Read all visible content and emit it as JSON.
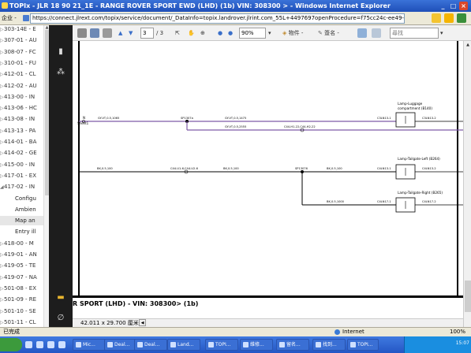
{
  "window": {
    "title": "TOPIx - JLR 18 90 21_1E - RANGE ROVER SPORT EWD (LHD) (1b) VIN: 308300 > - Windows Internet Explorer",
    "buttons": [
      "_",
      "□",
      "×"
    ]
  },
  "address": {
    "encoding": "企业 -",
    "url": "https://connect.jlrext.com/topix/service/document/_DataInfo=topix.landrover.jlrint.com_55L+4497697openProcedure=f75cc24c-ee49-4a5a-8dbd-9b47f4dc57b1#"
  },
  "tree": {
    "items": [
      {
        "label": "303-14E - E",
        "kind": "top"
      },
      {
        "label": "307-01 - AU",
        "kind": "top"
      },
      {
        "label": "308-07 - FC",
        "kind": "top"
      },
      {
        "label": "310-01 - FU",
        "kind": "top"
      },
      {
        "label": "412-01 - CL",
        "kind": "top"
      },
      {
        "label": "412-02 - AU",
        "kind": "top"
      },
      {
        "label": "413-00 - IN",
        "kind": "top"
      },
      {
        "label": "413-06 - HC",
        "kind": "top"
      },
      {
        "label": "413-08 - IN",
        "kind": "top"
      },
      {
        "label": "413-13 - PA",
        "kind": "top"
      },
      {
        "label": "414-01 - BA",
        "kind": "top"
      },
      {
        "label": "414-02 - GE",
        "kind": "top"
      },
      {
        "label": "415-00 - IN",
        "kind": "top"
      },
      {
        "label": "417-01 - EX",
        "kind": "top"
      },
      {
        "label": "417-02 - IN",
        "kind": "top"
      },
      {
        "label": "Configu",
        "kind": "child"
      },
      {
        "label": "Ambien",
        "kind": "child"
      },
      {
        "label": "Map an",
        "kind": "selected"
      },
      {
        "label": "Entry ill",
        "kind": "child"
      },
      {
        "label": "418-00 - M",
        "kind": "top"
      },
      {
        "label": "419-01 - AN",
        "kind": "top"
      },
      {
        "label": "419-05 - TE",
        "kind": "top"
      },
      {
        "label": "419-07 - NA",
        "kind": "top"
      },
      {
        "label": "501-08 - EX",
        "kind": "top"
      },
      {
        "label": "501-09 - RE",
        "kind": "top"
      },
      {
        "label": "501-10 - SE",
        "kind": "top"
      },
      {
        "label": "501-11 - CL",
        "kind": "top"
      }
    ]
  },
  "pdf_toolbar": {
    "page_current": "3",
    "page_total": "/ 3",
    "zoom": "90%",
    "tool_label": "物件 -",
    "sign_label": "簽名 -",
    "search_placeholder": "尋找"
  },
  "diagram": {
    "nets": [
      {
        "label": "GY-VT,0.5,1065"
      },
      {
        "label": "SP1307a"
      },
      {
        "label": "GY-VT,0.5,1475"
      },
      {
        "label": "C3LN13-1"
      },
      {
        "label": "GY-VT,0.5,2555"
      },
      {
        "label": "C44-H1-22,C44-H2-22"
      },
      {
        "label": "BK,0.5,100"
      },
      {
        "label": "C44-U1-6,C44-U2-6"
      },
      {
        "label": "BK,0.5,100"
      },
      {
        "label": "SP13076"
      },
      {
        "label": "BK,0.5,100"
      },
      {
        "label": "C4LN13-1"
      },
      {
        "label": "BK,0.5,1000"
      },
      {
        "label": "C4LN17-1"
      }
    ],
    "sheet_label": "N",
    "sheet_sub": "Sheet1",
    "loads": [
      {
        "name": "Lamp-Luggage compartment (B140)",
        "line1": "Lamp-Luggage",
        "line2": "compartment (B140)",
        "pin": "C3LN13-2"
      },
      {
        "name": "Lamp-Tailgate-Left (B264)",
        "line1": "Lamp-Tailgate-Left (B264)",
        "line2": "",
        "pin": "C4LN13-2"
      },
      {
        "name": "Lamp-Tailgate-Right (B265)",
        "line1": "Lamp-Tailgate-Right (B265)",
        "line2": "",
        "pin": "C4LN17-2"
      }
    ]
  },
  "footer": {
    "doc_title": "R SPORT  (LHD) - VIN: 308300>  (1b)",
    "dimensions": "42.011 x 29.700 厘米"
  },
  "status": {
    "left": "已完成",
    "zone": "Internet",
    "zoom": "100%"
  },
  "taskbar": {
    "tasks": [
      "Mic...",
      "Deal...",
      "Deal...",
      "Land...",
      "TOPI...",
      "维修...",
      "留名...",
      "找到...",
      "TOPI..."
    ],
    "clock": "15:07"
  }
}
